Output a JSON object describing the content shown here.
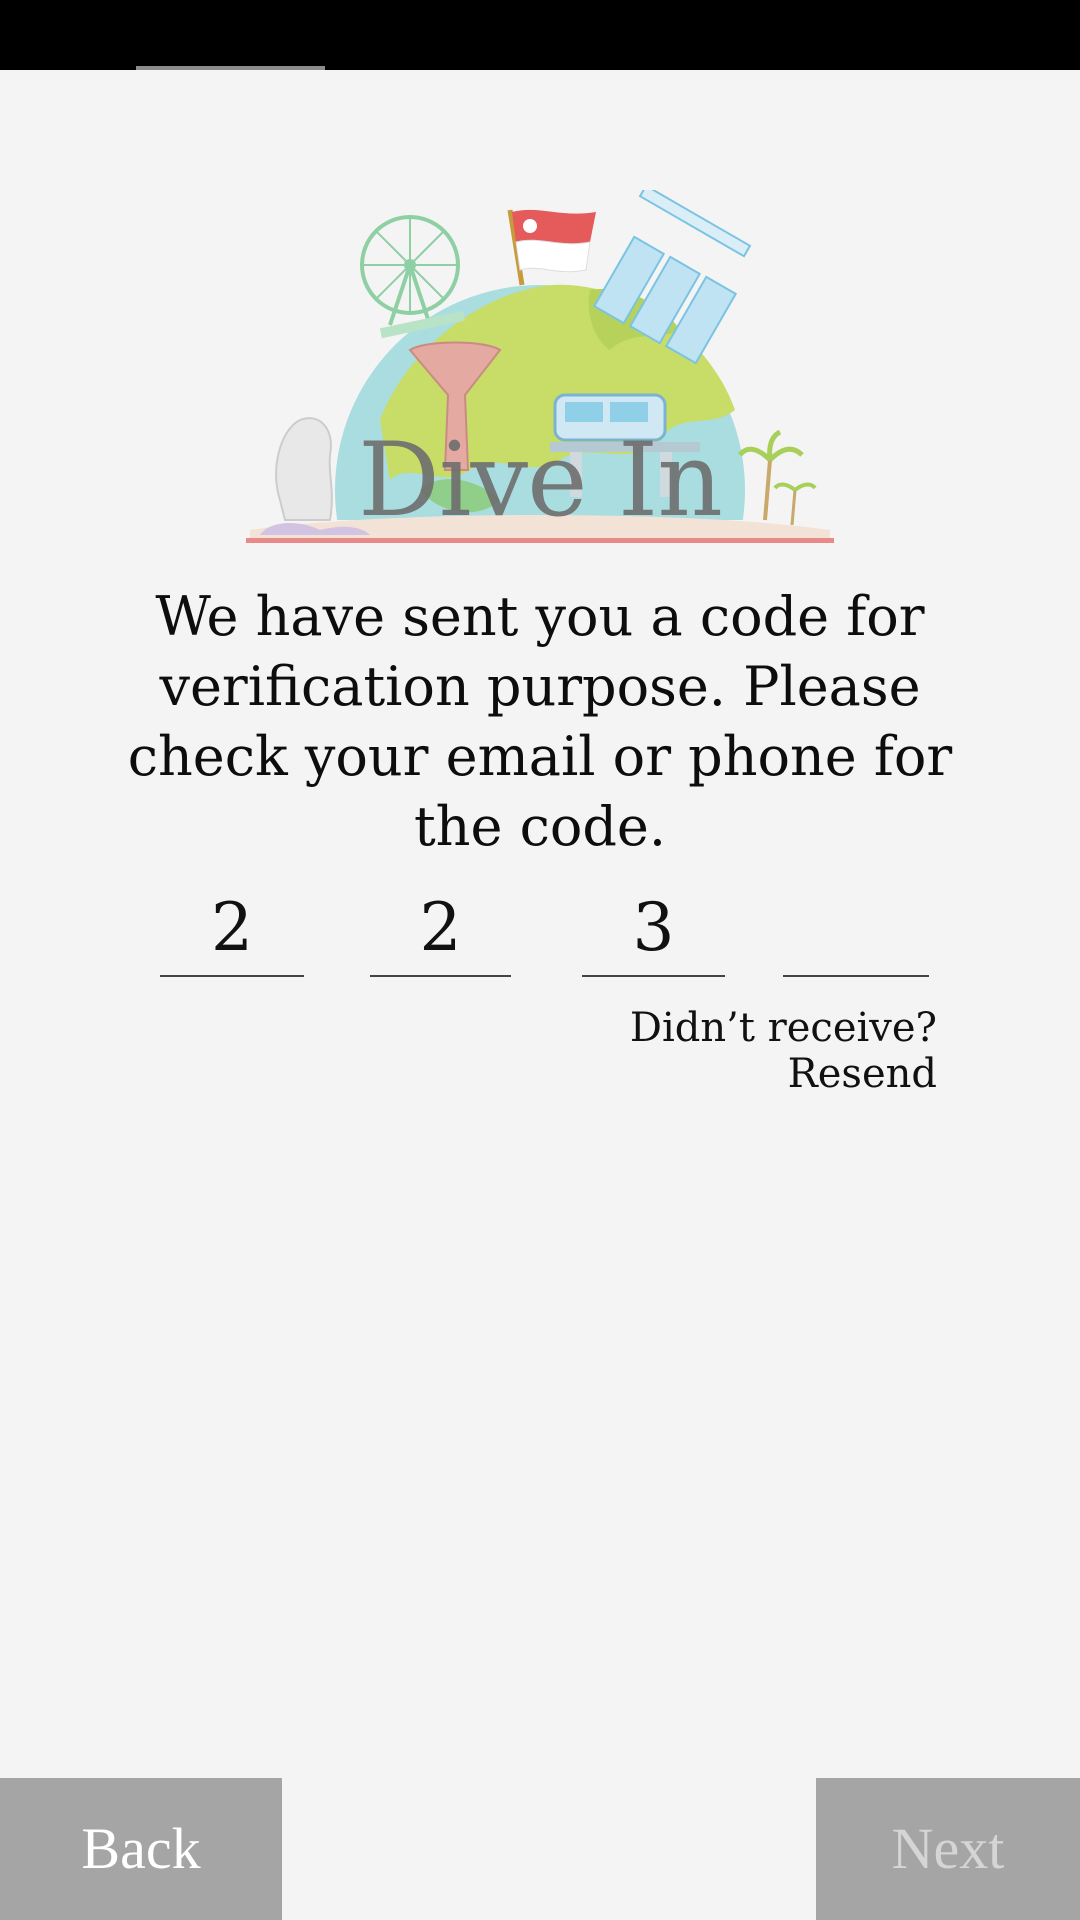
{
  "app": {
    "logo_text": "Dive In"
  },
  "message": "We have sent you a code for verification purpose. Please check your email or phone for the code.",
  "code": {
    "digits": [
      "2",
      "2",
      "3",
      ""
    ]
  },
  "resend_label": "Didn’t receive? Resend",
  "nav": {
    "back_label": "Back",
    "next_label": "Next"
  },
  "colors": {
    "background": "#f4f4f4",
    "button": "#a5a5a5",
    "status_bar": "#000000"
  }
}
